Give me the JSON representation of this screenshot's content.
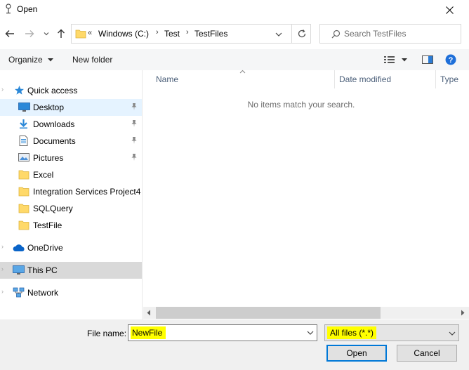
{
  "window": {
    "title": "Open"
  },
  "address_bar": {
    "overflow": "«",
    "crumbs": [
      "Windows (C:)",
      "Test",
      "TestFiles"
    ],
    "separator": "›"
  },
  "search": {
    "placeholder": "Search TestFiles",
    "value": ""
  },
  "command_bar": {
    "organize": "Organize",
    "new_folder": "New folder"
  },
  "nav": {
    "quick_access": "Quick access",
    "items": [
      {
        "label": "Desktop",
        "icon": "desktop-icon",
        "pinned": true,
        "selected": true
      },
      {
        "label": "Downloads",
        "icon": "download-icon",
        "pinned": true
      },
      {
        "label": "Documents",
        "icon": "document-icon",
        "pinned": true
      },
      {
        "label": "Pictures",
        "icon": "picture-icon",
        "pinned": true
      },
      {
        "label": "Excel",
        "icon": "folder-icon"
      },
      {
        "label": "Integration Services Project4",
        "icon": "folder-icon"
      },
      {
        "label": "SQLQuery",
        "icon": "folder-icon"
      },
      {
        "label": "TestFile",
        "icon": "folder-icon"
      }
    ],
    "onedrive": "OneDrive",
    "this_pc": "This PC",
    "network": "Network"
  },
  "columns": {
    "name": "Name",
    "date_modified": "Date modified",
    "type": "Type"
  },
  "empty_message": "No items match your search.",
  "footer": {
    "file_name_label": "File name:",
    "file_name_value": "NewFile",
    "file_type_value": "All files (*.*)",
    "open_label": "Open",
    "cancel_label": "Cancel"
  },
  "colors": {
    "accent": "#0078d7",
    "selected_light": "#e5f3ff",
    "highlight": "#ffff00",
    "folder": "#ffd969"
  }
}
